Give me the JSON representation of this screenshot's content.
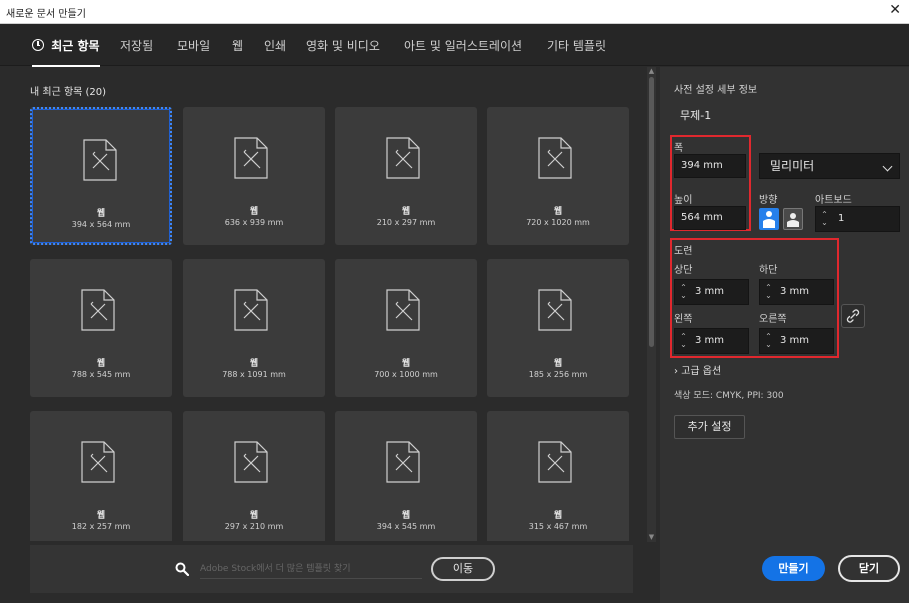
{
  "window": {
    "title": "새로운 문서 만들기",
    "close_glyph": "✕"
  },
  "tabs": [
    {
      "label": "최근 항목",
      "active": true,
      "icon": "clock-icon"
    },
    {
      "label": "저장됨"
    },
    {
      "label": "모바일"
    },
    {
      "label": "웹"
    },
    {
      "label": "인쇄"
    },
    {
      "label": "영화 및 비디오"
    },
    {
      "label": "아트 및 일러스트레이션"
    },
    {
      "label": "기타 템플릿"
    }
  ],
  "recent": {
    "section_title": "내 최근 항목 (20)",
    "items": [
      {
        "name": "웹",
        "size": "394 x 564 mm",
        "selected": true
      },
      {
        "name": "웹",
        "size": "636 x 939 mm"
      },
      {
        "name": "웹",
        "size": "210 x 297 mm"
      },
      {
        "name": "웹",
        "size": "720 x 1020 mm"
      },
      {
        "name": "웹",
        "size": "788 x 545 mm"
      },
      {
        "name": "웹",
        "size": "788 x 1091 mm"
      },
      {
        "name": "웹",
        "size": "700 x 1000 mm"
      },
      {
        "name": "웹",
        "size": "185 x 256 mm"
      },
      {
        "name": "웹",
        "size": "182 x 257 mm"
      },
      {
        "name": "웹",
        "size": "297 x 210 mm"
      },
      {
        "name": "웹",
        "size": "394 x 545 mm"
      },
      {
        "name": "웹",
        "size": "315 x 467 mm"
      }
    ]
  },
  "search": {
    "placeholder": "Adobe Stock에서 더 많은 템플릿 찾기",
    "value": "",
    "go_label": "이동"
  },
  "preset": {
    "heading": "사전 설정 세부 정보",
    "doc_name": "무제-1",
    "width_label": "폭",
    "width_value": "394 mm",
    "height_label": "높이",
    "height_value": "564 mm",
    "unit_value": "밀리미터",
    "orientation_label": "방향",
    "artboard_label": "아트보드",
    "artboard_value": "1",
    "bleed_label": "도련",
    "bleed_top_label": "상단",
    "bleed_top_value": "3 mm",
    "bleed_bottom_label": "하단",
    "bleed_bottom_value": "3 mm",
    "bleed_left_label": "왼쪽",
    "bleed_left_value": "3 mm",
    "bleed_right_label": "오른쪽",
    "bleed_right_value": "3 mm",
    "advanced_label": "고급 옵션",
    "color_mode": "색상 모드: CMYK, PPI: 300",
    "more_settings_label": "추가 설정",
    "create_label": "만들기",
    "close_label": "닫기"
  },
  "colors": {
    "accent": "#1473e6",
    "highlight": "#e0282e",
    "selection": "#3a87ff",
    "panel": "#323232",
    "card": "#3b3b3b"
  }
}
